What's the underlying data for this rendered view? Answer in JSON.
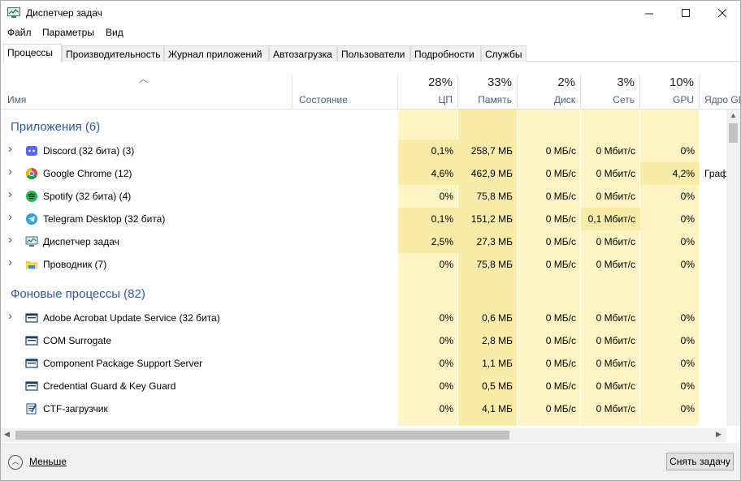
{
  "window": {
    "title": "Диспетчер задач",
    "minimize": "—",
    "maximize": "☐",
    "close": "✕"
  },
  "menu": [
    "Файл",
    "Параметры",
    "Вид"
  ],
  "tabs": [
    "Процессы",
    "Производительность",
    "Журнал приложений",
    "Автозагрузка",
    "Пользователи",
    "Подробности",
    "Службы"
  ],
  "header": {
    "name": "Имя",
    "status": "Состояние",
    "cpu": {
      "pct": "28%",
      "label": "ЦП"
    },
    "mem": {
      "pct": "33%",
      "label": "Память"
    },
    "disk": {
      "pct": "2%",
      "label": "Диск"
    },
    "net": {
      "pct": "3%",
      "label": "Сеть"
    },
    "gpu": {
      "pct": "10%",
      "label": "GPU"
    },
    "gpu_engine": "Ядро GPU"
  },
  "groups": {
    "apps": "Приложения (6)",
    "background": "Фоновые процессы (82)"
  },
  "apps": [
    {
      "name": "Discord (32 бита) (3)",
      "icon": "discord-icon",
      "cpu": "0,1%",
      "mem": "258,7 МБ",
      "disk": "0 МБ/с",
      "net": "0 Мбит/с",
      "gpu": "0%",
      "engine": ""
    },
    {
      "name": "Google Chrome (12)",
      "icon": "chrome-icon",
      "cpu": "4,6%",
      "mem": "462,9 МБ",
      "disk": "0 МБ/с",
      "net": "0 Мбит/с",
      "gpu": "4,2%",
      "engine": "Граф"
    },
    {
      "name": "Spotify (32 бита) (4)",
      "icon": "spotify-icon",
      "cpu": "0%",
      "mem": "75,8 МБ",
      "disk": "0 МБ/с",
      "net": "0 Мбит/с",
      "gpu": "0%",
      "engine": ""
    },
    {
      "name": "Telegram Desktop (32 бита)",
      "icon": "telegram-icon",
      "cpu": "0,1%",
      "mem": "151,2 МБ",
      "disk": "0 МБ/с",
      "net": "0,1 Мбит/с",
      "gpu": "0%",
      "engine": ""
    },
    {
      "name": "Диспетчер задач",
      "icon": "task-manager-icon",
      "cpu": "2,5%",
      "mem": "27,3 МБ",
      "disk": "0 МБ/с",
      "net": "0 Мбит/с",
      "gpu": "0%",
      "engine": ""
    },
    {
      "name": "Проводник (7)",
      "icon": "explorer-folder-icon",
      "cpu": "0%",
      "mem": "75,8 МБ",
      "disk": "0 МБ/с",
      "net": "0 Мбит/с",
      "gpu": "0%",
      "engine": ""
    }
  ],
  "background": [
    {
      "name": "Adobe Acrobat Update Service (32 бита)",
      "icon": "service-window-icon",
      "cpu": "0%",
      "mem": "0,6 МБ",
      "disk": "0 МБ/с",
      "net": "0 Мбит/с",
      "gpu": "0%"
    },
    {
      "name": "COM Surrogate",
      "icon": "service-window-icon",
      "cpu": "0%",
      "mem": "2,8 МБ",
      "disk": "0 МБ/с",
      "net": "0 Мбит/с",
      "gpu": "0%"
    },
    {
      "name": "Component Package Support Server",
      "icon": "service-window-icon",
      "cpu": "0%",
      "mem": "1,1 МБ",
      "disk": "0 МБ/с",
      "net": "0 Мбит/с",
      "gpu": "0%"
    },
    {
      "name": "Credential Guard & Key Guard",
      "icon": "service-window-icon",
      "cpu": "0%",
      "mem": "0,5 МБ",
      "disk": "0 МБ/с",
      "net": "0 Мбит/с",
      "gpu": "0%"
    },
    {
      "name": "CTF-загрузчик",
      "icon": "ctf-loader-icon",
      "cpu": "0%",
      "mem": "4,1 МБ",
      "disk": "0 МБ/с",
      "net": "0 Мбит/с",
      "gpu": "0%"
    }
  ],
  "footer": {
    "less": "Меньше",
    "end_task": "Снять задачу"
  },
  "colors": {
    "heat_light": "#fff4c4",
    "heat_mid": "#f9eca8",
    "heat_row": "#fff9e0",
    "group_text": "#2b5ca7"
  }
}
